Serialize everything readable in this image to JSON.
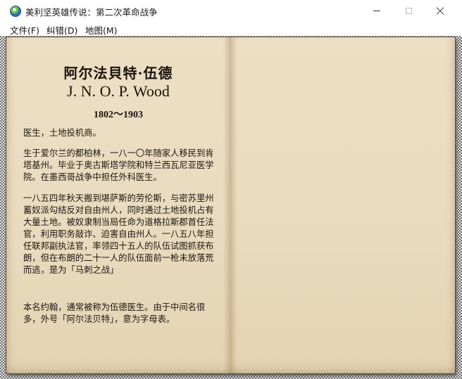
{
  "window": {
    "title": "美利坚英雄传说：第二次革命战争"
  },
  "menu": [
    {
      "label": "文件(F)"
    },
    {
      "label": "纠错(D)"
    },
    {
      "label": "地图(M)"
    }
  ],
  "entry": {
    "name_cn": "阿尔法貝特·伍德",
    "name_en": "J. N. O. P. Wood",
    "years": "1802～1903",
    "paragraphs": [
      "医生，土地投机商。",
      "生于爱尔兰的都柏林，一八一〇年随家人移民到肯塔基州。毕业于奥古斯塔学院和特兰西瓦尼亚医学院。在墨西哥战争中担任外科医生。",
      "一八五四年秋天搬到堪萨斯的劳伦斯，与密苏里州蓄奴派勾结反对自由州人，同时通过土地投机占有大量土地。被奴隶制当局任命为道格拉斯郡首任法官，利用职务敲诈、迫害自由州人。一八五八年担任联邦副执法官，率领四十五人的队伍试图抓获布朗，但在布朗的二十一人的队伍面前一枪未放落荒而逃，是为「马刺之战」",
      "本名约翰，通常被称为伍德医生。由于中间名很多，外号「阿尔法贝特」，意为字母表。"
    ]
  }
}
